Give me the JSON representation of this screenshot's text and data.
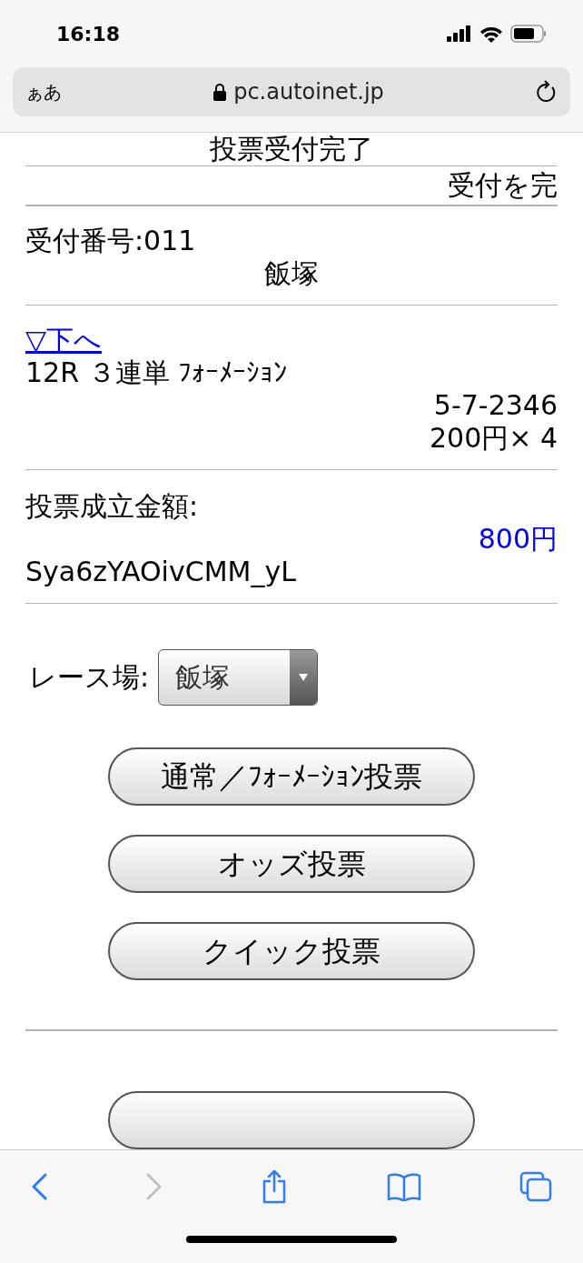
{
  "status_bar": {
    "time": "16:18"
  },
  "address_bar": {
    "text_size_button": "ぁあ",
    "url": "pc.autoinet.jp"
  },
  "page": {
    "title": "投票受付完了",
    "notice": "受付を完",
    "receipt_number": "受付番号:011",
    "venue": "飯塚",
    "jump_link": "▽下へ",
    "bet_type": "12R ３連単 ﾌｫｰﾒｰｼｮﾝ",
    "combination": "5-7-2346",
    "stake": "200円× 4",
    "total_label": "投票成立金額:",
    "total_amount": "800円",
    "code": "Sya6zYAOivCMM_yL",
    "venue_select": {
      "label": "レース場:",
      "value": "飯塚"
    },
    "buttons": [
      "通常／ﾌｫｰﾒｰｼｮﾝ投票",
      "オッズ投票",
      "クイック投票"
    ]
  },
  "toolbar": {
    "back_disabled": false,
    "forward_disabled": true
  }
}
